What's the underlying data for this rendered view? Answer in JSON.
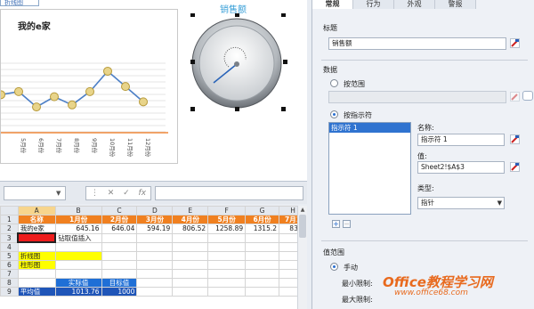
{
  "chart_tab_label": "折线图",
  "chart_data": {
    "type": "line",
    "title": "我的e家",
    "categories": [
      "",
      "",
      "5月份",
      "6月份",
      "7月份",
      "8月份",
      "9月份",
      "10月份",
      "11月份",
      "12月份"
    ],
    "values": [
      38,
      52,
      55,
      40,
      50,
      42,
      55,
      75,
      60,
      45
    ],
    "ylim": [
      0,
      100
    ]
  },
  "gauge": {
    "title": "销售额"
  },
  "sheet": {
    "formula_icons": [
      "⋮",
      "✕",
      "✓",
      "fx"
    ],
    "columns": [
      "A",
      "B",
      "C",
      "D",
      "E",
      "F",
      "G",
      "H"
    ],
    "rows": [
      {
        "n": "1",
        "cells": [
          "名称",
          "1月份",
          "2月份",
          "3月份",
          "4月份",
          "5月份",
          "6月份",
          "7月1"
        ]
      },
      {
        "n": "2",
        "cells": [
          "我的e家",
          "645.16",
          "646.04",
          "594.19",
          "806.52",
          "1258.89",
          "1315.2",
          "837."
        ]
      },
      {
        "n": "3",
        "cells": [
          "",
          "钻取值插入",
          "",
          "",
          "",
          "",
          "",
          ""
        ]
      },
      {
        "n": "4",
        "cells": [
          "",
          "",
          "",
          "",
          "",
          "",
          "",
          ""
        ]
      },
      {
        "n": "5",
        "cells": [
          "折线图",
          "",
          "",
          "",
          "",
          "",
          "",
          ""
        ]
      },
      {
        "n": "6",
        "cells": [
          "柱形图",
          "",
          "",
          "",
          "",
          "",
          "",
          ""
        ]
      },
      {
        "n": "7",
        "cells": [
          "",
          "",
          "",
          "",
          "",
          "",
          "",
          ""
        ]
      },
      {
        "n": "8",
        "cells": [
          "",
          "实际值",
          "目标值",
          "",
          "",
          "",
          "",
          ""
        ]
      },
      {
        "n": "9",
        "cells": [
          "平均值",
          "1013.76",
          "1000",
          "",
          "",
          "",
          "",
          ""
        ]
      }
    ]
  },
  "panel": {
    "tabs": [
      "常规",
      "行为",
      "外观",
      "警报"
    ],
    "title_label": "标题",
    "title_value": "销售额",
    "data_label": "数据",
    "by_range_label": "按范围",
    "by_indicator_label": "按指示符",
    "indicator_item": "指示符 1",
    "name_label": "名称:",
    "name_value": "指示符 1",
    "value_label": "值:",
    "value_value": "Sheet2!$A$3",
    "type_label": "类型:",
    "type_value": "指针",
    "range_label": "值范围",
    "manual_label": "手动",
    "min_label": "最小限制:",
    "max_label": "最大限制:"
  },
  "watermark": {
    "line1": "Office教程学习网",
    "line2": "www.office68.com"
  }
}
